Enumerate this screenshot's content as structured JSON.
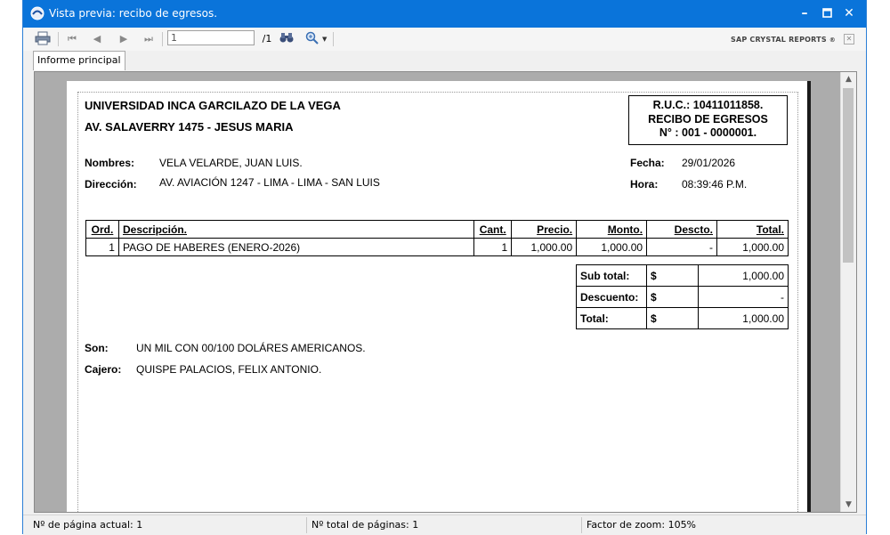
{
  "window": {
    "title": "Vista previa: recibo de egresos."
  },
  "toolbar": {
    "page_input": "1",
    "page_total": "/1",
    "brand": "SAP CRYSTAL REPORTS",
    "brand_mark": "®"
  },
  "tabs": [
    {
      "label": "Informe principal"
    }
  ],
  "receipt": {
    "institution": "UNIVERSIDAD INCA GARCILAZO DE LA VEGA",
    "address_line": "AV. SALAVERRY 1475 - JESUS MARIA",
    "ruc": "R.U.C.: 10411011858.",
    "doc_type": "RECIBO DE EGRESOS",
    "doc_number": "N° : 001 - 0000001.",
    "nombres_label": "Nombres:",
    "nombres_value": "VELA VELARDE, JUAN LUIS.",
    "direccion_label": "Dirección:",
    "direccion_value": "AV. AVIACIÓN 1247 - LIMA - LIMA - SAN LUIS",
    "fecha_label": "Fecha:",
    "fecha_value": "29/01/2026",
    "hora_label": "Hora:",
    "hora_value": "08:39:46 P.M.",
    "columns": [
      "Ord.",
      "Descripción.",
      "Cant.",
      "Precio.",
      "Monto.",
      "Descto.",
      "Total."
    ],
    "rows": [
      {
        "ord": "1",
        "descripcion": "PAGO DE HABERES (ENERO-2026)",
        "cant": "1",
        "precio": "1,000.00",
        "monto": "1,000.00",
        "descto": "-",
        "total": "1,000.00"
      }
    ],
    "totals": [
      {
        "label": "Sub total:",
        "currency": "$",
        "value": "1,000.00"
      },
      {
        "label": "Descuento:",
        "currency": "$",
        "value": "-"
      },
      {
        "label": "Total:",
        "currency": "$",
        "value": "1,000.00"
      }
    ],
    "son_label": "Son:",
    "son_value": "UN MIL CON  00/100  DOLÁRES AMERICANOS.",
    "cajero_label": "Cajero:",
    "cajero_value": "QUISPE PALACIOS, FELIX ANTONIO."
  },
  "status": {
    "current_page": "Nº de página actual: 1",
    "total_pages": "Nº total de páginas: 1",
    "zoom": "Factor de zoom: 105%"
  },
  "colors": {
    "titlebar": "#0a74da",
    "viewer_bg": "#acacac"
  }
}
